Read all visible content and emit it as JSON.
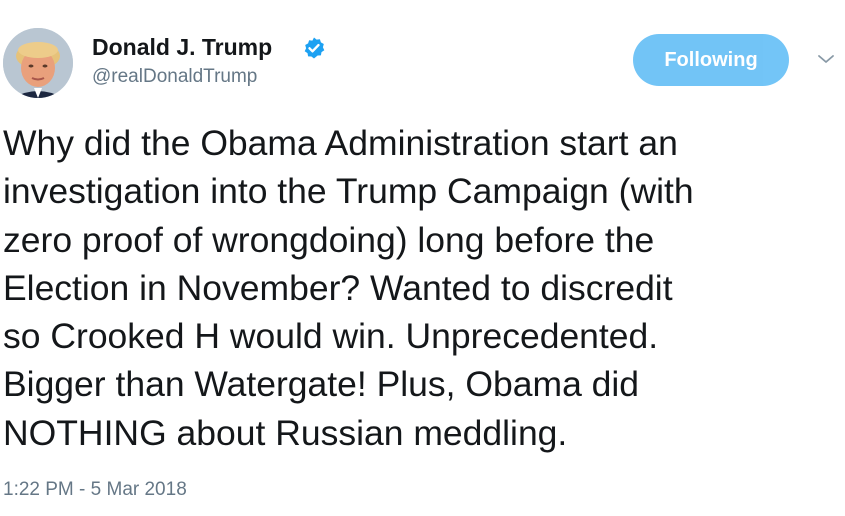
{
  "author": {
    "display_name": "Donald J. Trump",
    "handle": "@realDonaldTrump",
    "verified": true,
    "avatar_icon": "user-avatar-photo"
  },
  "follow_button": {
    "label": "Following"
  },
  "menu": {
    "icon": "chevron-down-icon"
  },
  "tweet": {
    "lines": [
      "Why did the Obama Administration start an",
      "investigation into the Trump Campaign (with",
      "zero proof of wrongdoing) long before the",
      "Election in November? Wanted to discredit",
      "so Crooked H would win. Unprecedented.",
      "Bigger than Watergate! Plus, Obama did",
      "NOTHING about Russian meddling."
    ],
    "timestamp": "1:22 PM - 5 Mar 2018"
  },
  "colors": {
    "accent": "#1da1f2",
    "text": "#14171a",
    "secondary": "#657786"
  }
}
